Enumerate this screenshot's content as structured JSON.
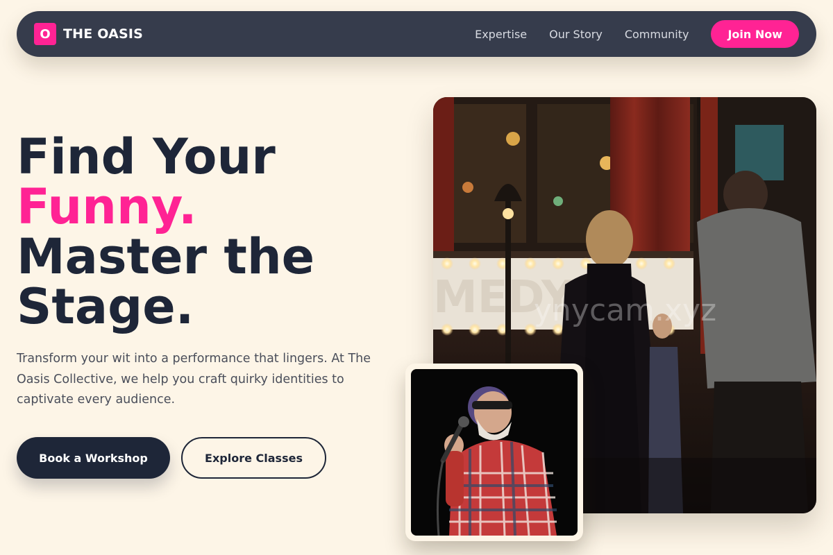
{
  "nav": {
    "logo_letter": "O",
    "brand": "THE OASIS",
    "links": [
      "Expertise",
      "Our Story",
      "Community"
    ],
    "cta": "Join Now"
  },
  "hero": {
    "title_line1": "Find Your",
    "title_accent": "Funny.",
    "title_line3": "Master the",
    "title_line4": "Stage.",
    "description": "Transform your wit into a performance that lingers. At The Oasis Collective, we help you craft quirky identities to captivate every audience.",
    "primary_button": "Book a Workshop",
    "secondary_button": "Explore Classes"
  },
  "images": {
    "main_alt": "comedy club entrance with marquee lights",
    "main_watermark": "ynycam.xyz",
    "inset_alt": "comedian performing at microphone"
  },
  "colors": {
    "background": "#fdf5e7",
    "navbar": "#363c4c",
    "accent": "#ff2394",
    "dark": "#1e2638"
  }
}
